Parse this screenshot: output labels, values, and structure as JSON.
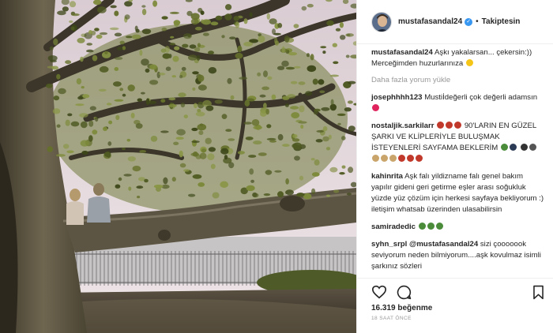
{
  "post": {
    "username": "mustafasandal24",
    "verified_badge": "✓",
    "separator": "•",
    "follow_status": "Takiptesin",
    "caption_user": "mustafasandal24",
    "caption_text": "Aşkı yakalarsan... çekersin:)) Merceğimden huzurlarınıza"
  },
  "load_more": "Daha fazla yorum yükle",
  "comments": [
    {
      "user": "josephhhh123",
      "text": "Mustiİdeğerli çok değerli adamsın"
    },
    {
      "user": "nostaljik.sarkilarr",
      "text": "90'LARIN EN GÜZEL ŞARKI VE KLİPLERİYLE BULUŞMAK İSTEYENLERİ SAYFAMA BEKLERİM"
    },
    {
      "user": "kahinrita",
      "text": "Aşk falı yildizname falı genel bakım yapılır gideni geri getirme eşler arası soğukluk yüzde yüz çözüm için herkesi sayfaya bekliyorum :) iletişim whatsab üzerinden ulasabilirsin"
    },
    {
      "user": "samiradedic",
      "text": ""
    },
    {
      "user": "syhn_srpl",
      "mention": "@mustafasandal24",
      "text": " sizi çooooook seviyorum neden bilmiyorum....aşk kovulmaz isimli şarkınız sözleri"
    }
  ],
  "likes": "16.319 beğenme",
  "timestamp": "18 SAAT ÖNCE",
  "icons": {
    "like": "heart-icon",
    "comment": "comment-icon",
    "save": "bookmark-icon",
    "verified": "verified-badge-icon"
  },
  "colors": {
    "verified": "#3897f0",
    "emoji_red": "#c0392b",
    "emoji_heart": "#e0245e",
    "emoji_yellow": "#f5c518",
    "text_muted": "#999999",
    "divider": "#efefef"
  }
}
